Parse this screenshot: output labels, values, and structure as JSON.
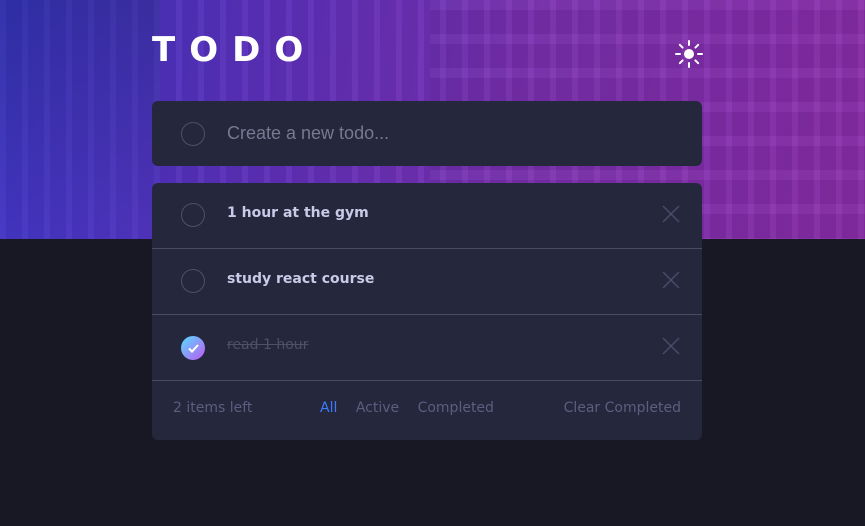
{
  "app": {
    "title": "TODO"
  },
  "new_todo": {
    "placeholder": "Create a new todo..."
  },
  "todos": [
    {
      "text": "1 hour at the gym",
      "completed": false
    },
    {
      "text": "study react course",
      "completed": false
    },
    {
      "text": "read 1 hour",
      "completed": true
    }
  ],
  "footer": {
    "items_left": "2 items left",
    "filters": [
      "All",
      "Active",
      "Completed"
    ],
    "active_filter": "All",
    "clear": "Clear Completed"
  },
  "icons": {
    "theme": "sun-icon",
    "delete": "cross-icon",
    "check": "check-icon"
  },
  "colors": {
    "background": "#171823",
    "card": "#25273d",
    "accent": "#3a7cfd",
    "check_gradient": [
      "#55ddff",
      "#c058f3"
    ]
  }
}
